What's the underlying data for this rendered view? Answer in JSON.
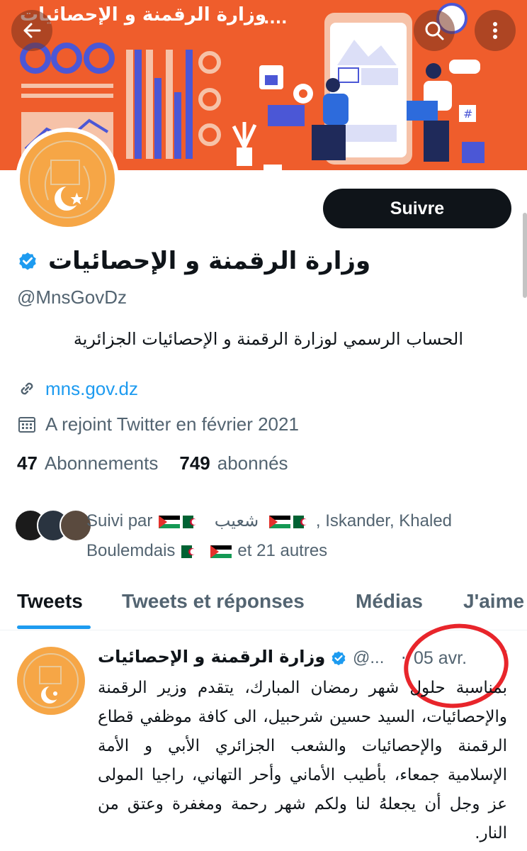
{
  "banner": {
    "title": "وزارة الرقمنة و الإحصائيات",
    "dots": "....",
    "colors": {
      "background": "#ef5d2c",
      "bars": "#4b57d6",
      "card": "#f6c2a8"
    }
  },
  "header": {
    "back_icon": "arrow-left-icon",
    "search_icon": "search-icon",
    "more_icon": "more-vertical-icon"
  },
  "profile": {
    "follow_label": "Suivre",
    "name": "وزارة الرقمنة و الإحصائيات",
    "handle": "@MnsGovDz",
    "bio": "الحساب الرسمي لوزارة الرقمنة و الإحصائيات الجزائرية",
    "website": "mns.gov.dz",
    "joined": "A rejoint Twitter en février 2021",
    "following_count": "47",
    "following_label": "Abonnements",
    "followers_count": "749",
    "followers_label": "abonnés",
    "followed_by": {
      "prefix": "Suivi par",
      "name1": "شعيب",
      "rest": ", Iskander, Khaled",
      "line2_name": "Boulemdais",
      "suffix": "et 21 autres"
    }
  },
  "tabs": [
    {
      "label": "Tweets",
      "active": true
    },
    {
      "label": "Tweets et réponses",
      "active": false
    },
    {
      "label": "Médias",
      "active": false
    },
    {
      "label": "J'aime",
      "active": false
    }
  ],
  "tweet": {
    "author": "وزارة الرقمنة و الإحصائيات",
    "handle": "@...",
    "separator": "·",
    "date": "05 avr.",
    "text": "بمناسبة حلول شهر رمضان المبارك، يتقدم وزير الرقمنة والإحصائيات، السيد حسين شرحبيل، الى كافة موظفي قطاع الرقمنة والإحصائيات والشعب الجزائري الأبي و الأمة الإسلامية جمعاء، بأطيب الأماني وأحر التهاني، راجيا المولى عز وجل أن يجعلهُ لنا ولكم شهر رحمة ومغفرة وعتق من النار."
  },
  "colors": {
    "accent": "#1d9bf0",
    "avatar": "#f6a646",
    "highlight": "#e8252b",
    "text_secondary": "#536471"
  }
}
